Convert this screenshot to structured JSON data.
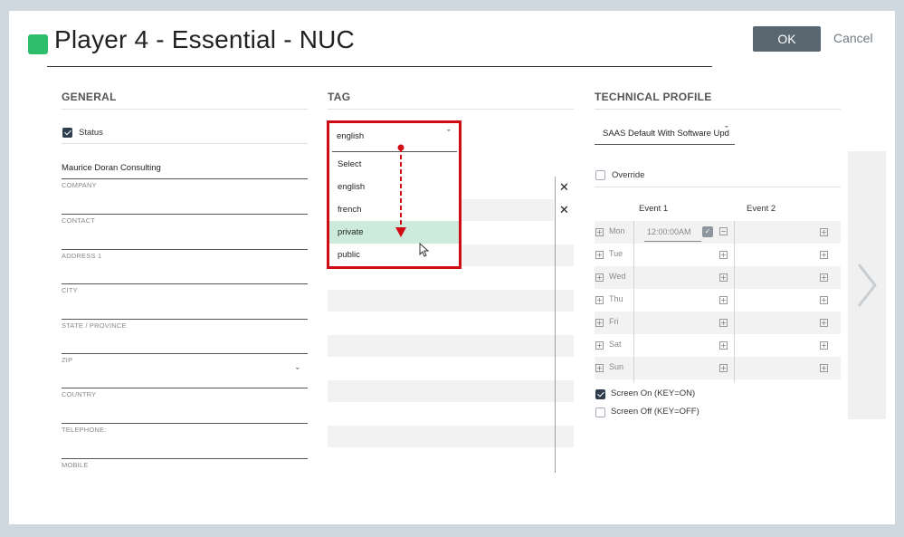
{
  "header": {
    "title": "Player 4 - Essential - NUC",
    "status_color": "#2ebd6b",
    "ok_label": "OK",
    "cancel_label": "Cancel"
  },
  "general": {
    "section_title": "GENERAL",
    "status_label": "Status",
    "status_checked": true,
    "fields": [
      {
        "label": "COMPANY",
        "value": "Maurice Doran Consulting"
      },
      {
        "label": "CONTACT",
        "value": ""
      },
      {
        "label": "ADDRESS 1",
        "value": ""
      },
      {
        "label": "CITY",
        "value": ""
      },
      {
        "label": "STATE / PROVINCE",
        "value": ""
      },
      {
        "label": "ZIP",
        "value": ""
      },
      {
        "label": "COUNTRY",
        "value": ""
      },
      {
        "label": "TELEPHONE:",
        "value": ""
      },
      {
        "label": "MOBILE",
        "value": ""
      }
    ]
  },
  "tag": {
    "section_title": "TAG",
    "selected_value": "english",
    "options": [
      "Select",
      "english",
      "french",
      "private",
      "public"
    ],
    "highlighted_option": "private"
  },
  "technical_profile": {
    "section_title": "TECHNICAL PROFILE",
    "profile_value": "SAAS Default With Software Upd",
    "override_label": "Override",
    "event_headers": [
      "Event 1",
      "Event 2"
    ],
    "days": [
      "Mon",
      "Tue",
      "Wed",
      "Thu",
      "Fri",
      "Sat",
      "Sun"
    ],
    "mon_event1_time": "12:00:00AM",
    "screen_on_label": "Screen On (KEY=ON)",
    "screen_on_checked": true,
    "screen_off_label": "Screen Off (KEY=OFF)",
    "screen_off_checked": false
  },
  "icons": {
    "chevron": "ˇ",
    "close": "✕",
    "plus": "+",
    "minus": "−",
    "next": "chevron-right-icon"
  },
  "colors": {
    "accent_dark": "#2f3d4e",
    "highlight_red": "#d10b14",
    "option_highlight": "#cdebdc"
  }
}
